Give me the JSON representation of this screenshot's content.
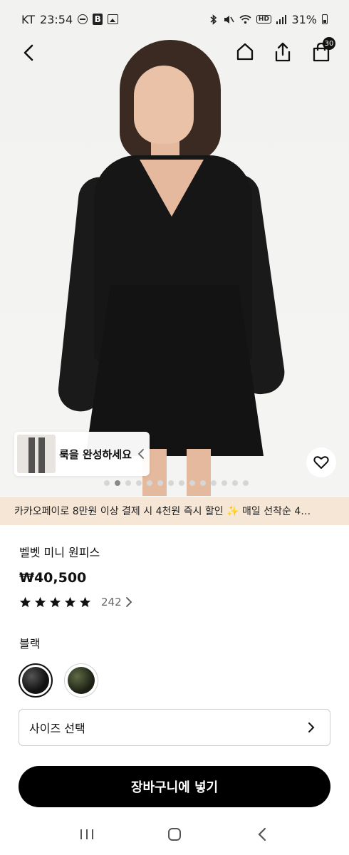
{
  "status_bar": {
    "carrier": "KT",
    "time": "23:54",
    "battery": "31%",
    "hd_label": "HD"
  },
  "header": {
    "cart_count": "30"
  },
  "hero": {
    "look_text": "룩을 완성하세요",
    "dots_total": 14,
    "dots_active_index": 1
  },
  "promo": {
    "text": "카카오페이로 8만원 이상 결제 시 4천원 즉시 할인 ✨ 매일 선착순 4…"
  },
  "product": {
    "title": "벨벳  미니 원피스",
    "price": "₩40,500",
    "rating_stars": 5,
    "review_count": "242"
  },
  "options": {
    "color_label": "블랙",
    "size_select_label": "사이즈 선택"
  },
  "actions": {
    "add_to_cart_label": "장바구니에 넣기"
  },
  "colors": {
    "promo_bg": "#f6e6d6",
    "primary_button": "#000000"
  }
}
